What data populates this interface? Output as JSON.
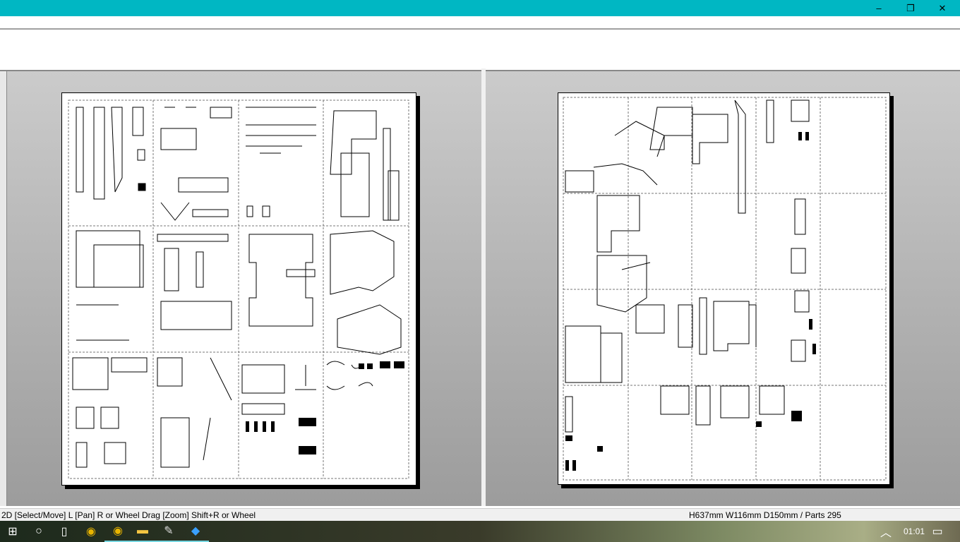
{
  "window": {
    "controls": {
      "minimize": "–",
      "restore": "❐",
      "close": "✕"
    },
    "accent": "#00b7c3"
  },
  "status": {
    "left": "2D [Select/Move] L [Pan] R or Wheel Drag [Zoom] Shift+R or Wheel",
    "right": "H637mm W116mm D150mm / Parts 295"
  },
  "taskbar": {
    "clock": "01:01",
    "icons": [
      "windows-start-icon",
      "cortana-icon",
      "task-view-icon",
      "chrome-icon",
      "chrome-icon",
      "file-explorer-icon",
      "paint-icon",
      "pepakura-icon"
    ]
  }
}
